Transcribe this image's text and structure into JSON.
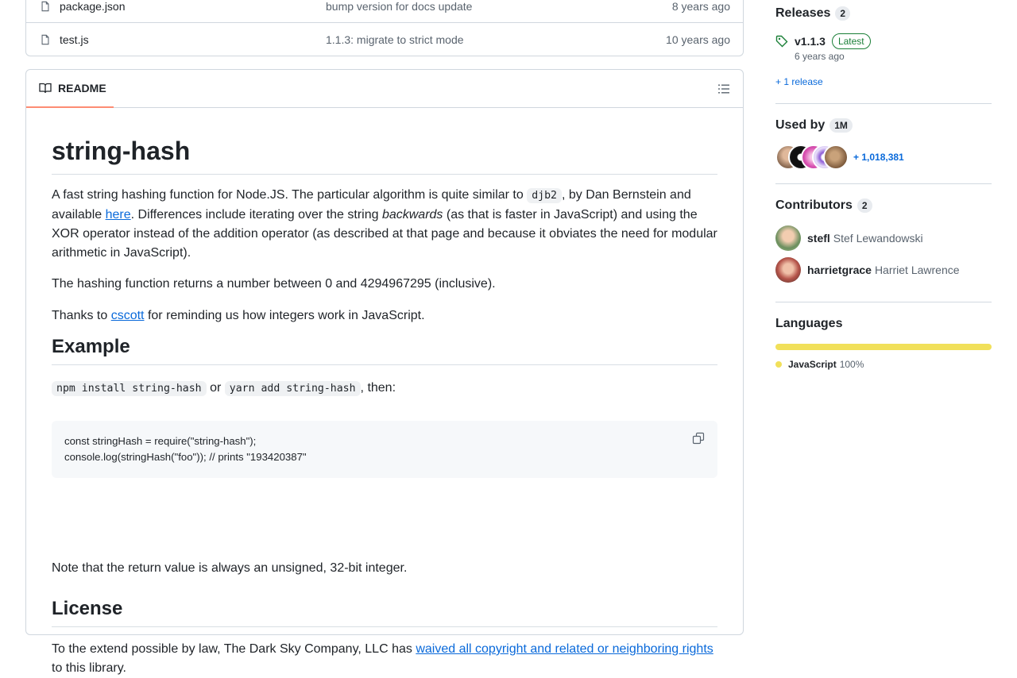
{
  "files": [
    {
      "name": "package.json",
      "message": "bump version for docs update",
      "time": "8 years ago"
    },
    {
      "name": "test.js",
      "message": "1.1.3: migrate to strict mode",
      "time": "10 years ago"
    }
  ],
  "readme": {
    "tab_label": "README",
    "title": "string-hash",
    "p1_a": "A fast string hashing function for Node.JS. The particular algorithm is quite similar to ",
    "p1_code": "djb2",
    "p1_b": ", by Dan Bernstein and available ",
    "p1_link": "here",
    "p1_c": ". Differences include iterating over the string ",
    "p1_em": "backwards",
    "p1_d": " (as that is faster in JavaScript) and using the XOR operator instead of the addition operator (as described at that page and because it obviates the need for modular arithmetic in JavaScript).",
    "p2": "The hashing function returns a number between 0 and 4294967295 (inclusive).",
    "p3_a": "Thanks to ",
    "p3_link": "cscott",
    "p3_b": " for reminding us how integers work in JavaScript.",
    "h_example": "Example",
    "ex_code1": "npm install string-hash",
    "ex_or": " or ",
    "ex_code2": "yarn add string-hash",
    "ex_then": ", then:",
    "code_block": "const stringHash = require(\"string-hash\");\nconsole.log(stringHash(\"foo\")); // prints \"193420387\"",
    "p_note": "Note that the return value is always an unsigned, 32-bit integer.",
    "h_license": "License",
    "lic_a": "To the extend possible by law, The Dark Sky Company, LLC has ",
    "lic_link": "waived all copyright and related or neighboring rights",
    "lic_b": " to this library."
  },
  "sidebar": {
    "releases": {
      "title": "Releases",
      "count": "2",
      "tag": "v1.1.3",
      "badge": "Latest",
      "time": "6 years ago",
      "more": "+ 1 release"
    },
    "used_by": {
      "title": "Used by",
      "count": "1M",
      "more": "+ 1,018,381"
    },
    "contributors": {
      "title": "Contributors",
      "count": "2",
      "people": [
        {
          "login": "stefl",
          "name": "Stef Lewandowski"
        },
        {
          "login": "harrietgrace",
          "name": "Harriet Lawrence"
        }
      ]
    },
    "languages": {
      "title": "Languages",
      "items": [
        {
          "name": "JavaScript",
          "percent": "100%",
          "share": 1.0,
          "color": "#f1e05a"
        }
      ]
    }
  },
  "colors": {
    "accent": "#0969da",
    "tab_underline": "#fd8c73",
    "latest_green": "#1a7f37",
    "javascript": "#f1e05a"
  }
}
